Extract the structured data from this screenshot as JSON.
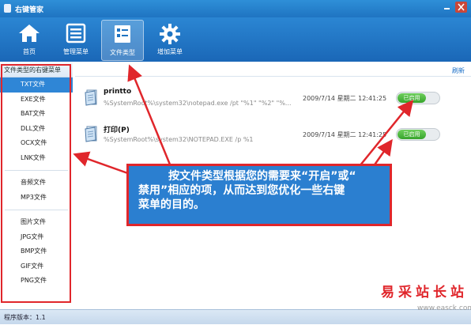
{
  "window": {
    "title": "右键管家"
  },
  "toolbar": [
    {
      "label": "首页",
      "icon": "home-icon"
    },
    {
      "label": "管理菜单",
      "icon": "list-icon"
    },
    {
      "label": "文件类型",
      "icon": "file-types-icon"
    },
    {
      "label": "增加菜单",
      "icon": "gear-icon"
    }
  ],
  "sidebar": {
    "header": "文件类型的右键菜单",
    "groups": [
      [
        "TXT文件",
        "EXE文件",
        "BAT文件",
        "DLL文件",
        "OCX文件",
        "LNK文件"
      ],
      [
        "音频文件",
        "MP3文件"
      ],
      [
        "图片文件",
        "JPG文件",
        "BMP文件",
        "GIF文件",
        "PNG文件"
      ]
    ],
    "selected": "TXT文件"
  },
  "content": {
    "refresh": "刷新",
    "items": [
      {
        "name": "printto",
        "command": "%SystemRoot%\\system32\\notepad.exe /pt \"%1\" \"%2\" \"%...",
        "time": "2009/7/14 星期二 12:41:25",
        "status": "已启用"
      },
      {
        "name": "打印(P)",
        "command": "%SystemRoot%\\system32\\NOTEPAD.EXE /p %1",
        "time": "2009/7/14 星期二 12:41:25",
        "status": "已启用"
      }
    ]
  },
  "callout": {
    "lines": [
      "按文件类型根据您的需要来“开启”或“",
      "禁用”相应的项，从而达到您优化一些右键",
      "菜单的目的。"
    ]
  },
  "statusbar": {
    "text": "程序版本：1.1"
  },
  "watermark": {
    "text": "易采站长站",
    "url": "www.easck.com"
  },
  "colors": {
    "accent": "#2b86d3",
    "highlight": "#e0262b",
    "toggle_on": "#36a42b"
  }
}
